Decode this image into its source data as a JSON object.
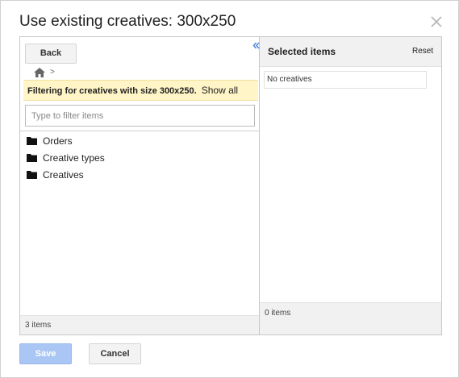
{
  "dialog": {
    "title": "Use existing creatives: 300x250"
  },
  "left_panel": {
    "back_label": "Back",
    "breadcrumb_separator": ">",
    "filter_message": "Filtering for creatives with size 300x250.",
    "show_all_label": "Show all",
    "filter_placeholder": "Type to filter items",
    "tree_items": [
      {
        "label": "Orders",
        "icon": "folder-icon"
      },
      {
        "label": "Creative types",
        "icon": "folder-icon"
      },
      {
        "label": "Creatives",
        "icon": "folder-icon"
      }
    ],
    "footer_count": "3 items"
  },
  "right_panel": {
    "header_label": "Selected items",
    "reset_label": "Reset",
    "empty_message": "No creatives",
    "footer_count": "0 items"
  },
  "actions": {
    "save_label": "Save",
    "cancel_label": "Cancel"
  },
  "colors": {
    "filter_bar_bg": "#fff5c7",
    "save_disabled_bg": "#a9c6f5",
    "collapse_arrow": "#4a7fd4"
  }
}
